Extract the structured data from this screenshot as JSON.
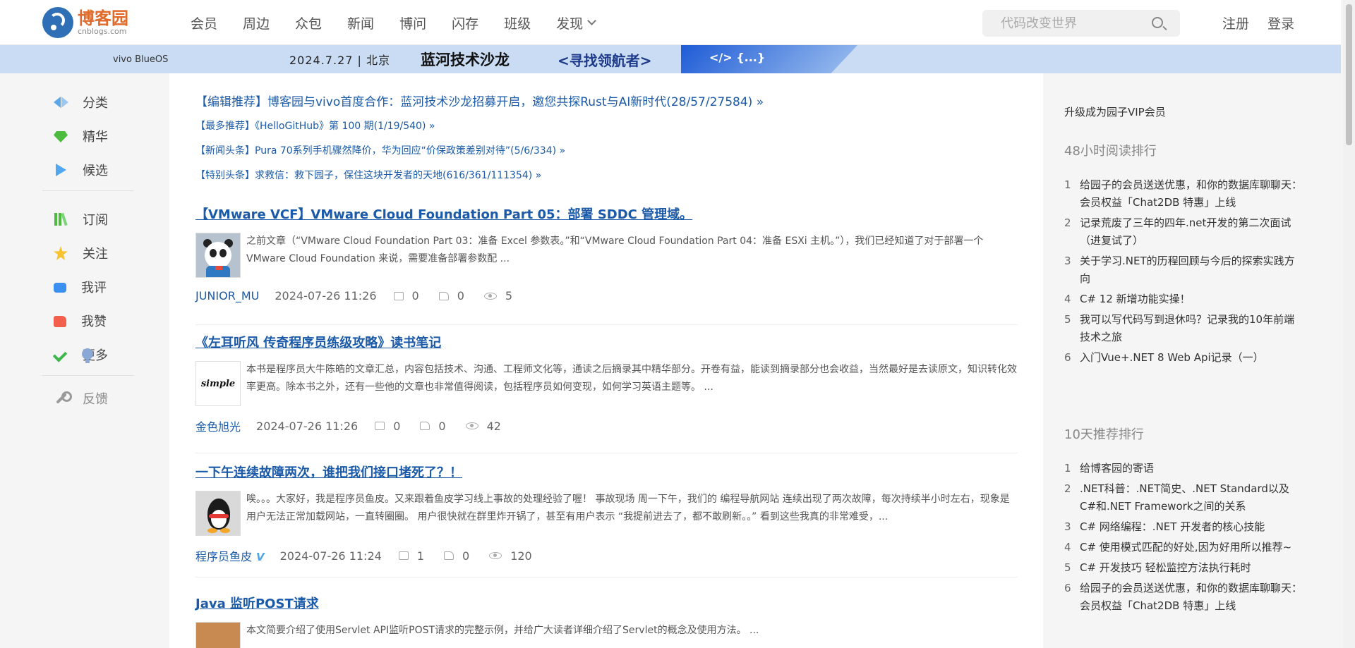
{
  "header": {
    "logo_cn": "博客园",
    "logo_en": "cnblogs.com",
    "nav": [
      "会员",
      "周边",
      "众包",
      "新闻",
      "博问",
      "闪存",
      "班级",
      "发现"
    ],
    "search_placeholder": "代码改变世界",
    "register": "注册",
    "login": "登录"
  },
  "banner": {
    "brand": "vivo  BlueOS",
    "date": "2024.7.27 | 北京",
    "title": "蓝河技术沙龙",
    "slogan": "<寻找领航者>",
    "deco": "</> {...}"
  },
  "leftbar": {
    "items": [
      "分类",
      "精华",
      "候选",
      "订阅",
      "关注",
      "我评",
      "我赞",
      "更多",
      "反馈"
    ]
  },
  "main": {
    "rec_big": "【编辑推荐】博客园与vivo首度合作：蓝河技术沙龙招募开启，邀您共探Rust与AI新时代(28/57/27584) »",
    "recs": [
      "【最多推荐】《HelloGitHub》第 100 期(1/19/540) »",
      "【新闻头条】Pura 70系列手机骤然降价，华为回应“价保政策差别对待”(5/6/334) »",
      "【特别头条】求救信：救下园子，保住这块开发者的天地(616/361/111354) »"
    ],
    "posts": [
      {
        "title": "【VMware VCF】VMware Cloud Foundation Part 05：部署 SDDC 管理域。",
        "summary": "之前文章（“VMware Cloud Foundation Part 03：准备 Excel 参数表。”和“VMware Cloud Foundation Part 04：准备 ESXi 主机。”），我们已经知道了对于部署一个 VMware Cloud Foundation 来说，需要准备部署参数配 ...",
        "author": "JUNIOR_MU",
        "date": "2024-07-26 11:26",
        "comments": "0",
        "likes": "0",
        "views": "5"
      },
      {
        "title": "《左耳听风 传奇程序员练级攻略》读书笔记",
        "summary": "本书是程序员大牛陈皓的文章汇总，内容包括技术、沟通、工程师文化等，通读之后摘录其中精华部分。开卷有益，能读到摘录部分也会收益，当然最好是去读原文，知识转化效率更高。除本书之外，还有一些他的文章也非常值得阅读，包括程序员如何变现，如何学习英语主题等。 ...",
        "author": "金色旭光",
        "date": "2024-07-26 11:26",
        "comments": "0",
        "likes": "0",
        "views": "42",
        "avatar_text": "simple"
      },
      {
        "title": "一下午连续故障两次，谁把我们接口堵死了？！",
        "summary": "唉。。。大家好，我是程序员鱼皮。又来跟着鱼皮学习线上事故的处理经验了喔！ 事故现场 周一下午，我们的 编程导航网站 连续出现了两次故障，每次持续半小时左右，现象是用户无法正常加载网站，一直转圈圈。 用户很快就在群里炸开锅了，甚至有用户表示 “我提前进去了，都不敢刷新。。” 看到这些我真的非常难受，...",
        "author": "程序员鱼皮",
        "date": "2024-07-26 11:24",
        "comments": "1",
        "likes": "0",
        "views": "120",
        "badge": "V"
      },
      {
        "title": "Java 监听POST请求",
        "summary": "本文简要介绍了使用Servlet API监听POST请求的完整示例，并给广大读者详细介绍了Servlet的概念及使用方法。 ..."
      }
    ]
  },
  "rightbar": {
    "vip": "升级成为园子VIP会员",
    "read48_title": "48小时阅读排行",
    "read48": [
      "给园子的会员送送优惠，和你的数据库聊聊天：会员权益「Chat2DB 特惠」上线",
      "记录荒废了三年的四年.net开发的第二次面试（进复试了）",
      "关于学习.NET的历程回顾与今后的探索实践方向",
      "C# 12 新增功能实操！",
      "我可以写代码写到退休吗？记录我的10年前端技术之旅",
      "入门Vue+.NET 8 Web Api记录（一）"
    ],
    "rec10_title": "10天推荐排行",
    "rec10": [
      "给博客园的寄语",
      ".NET科普：.NET简史、.NET Standard以及C#和.NET Framework之间的关系",
      "C# 网络编程：.NET 开发者的核心技能",
      "C# 使用模式匹配的好处,因为好用所以推荐~",
      "C# 开发技巧 轻松监控方法执行耗时",
      "给园子的会员送送优惠，和你的数据库聊聊天：会员权益「Chat2DB 特惠」上线"
    ],
    "nums": [
      "1",
      "2",
      "3",
      "4",
      "5",
      "6"
    ]
  }
}
